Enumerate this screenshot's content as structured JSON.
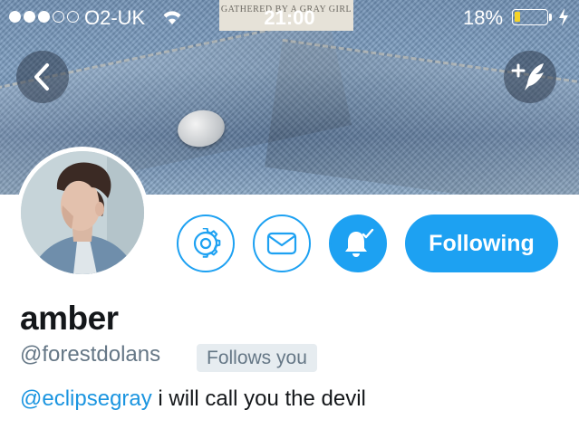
{
  "status_bar": {
    "carrier": "O2-UK",
    "time": "21:00",
    "battery_percent": "18%",
    "battery_level": 0.18,
    "signal_bars_filled": 3,
    "signal_bars_total": 5
  },
  "banner": {
    "label_text": "GATHERED BY A GRAY GIRL"
  },
  "nav": {
    "back_icon": "chevron-left-icon",
    "compose_icon": "compose-tweet-icon"
  },
  "profile": {
    "name": "amber",
    "handle": "@forestdolans",
    "follows_you_badge": "Follows you",
    "bio_mention": "@eclipsegray",
    "bio_text": " i will call you the devil"
  },
  "actions": {
    "settings_icon": "gear-icon",
    "message_icon": "envelope-icon",
    "notifications_icon": "bell-check-icon",
    "following_label": "Following"
  },
  "colors": {
    "accent": "#1da1f2",
    "mention": "#1b95e0",
    "secondary_text": "#657786",
    "primary_text": "#14171a",
    "battery_fill": "#f5d327"
  }
}
